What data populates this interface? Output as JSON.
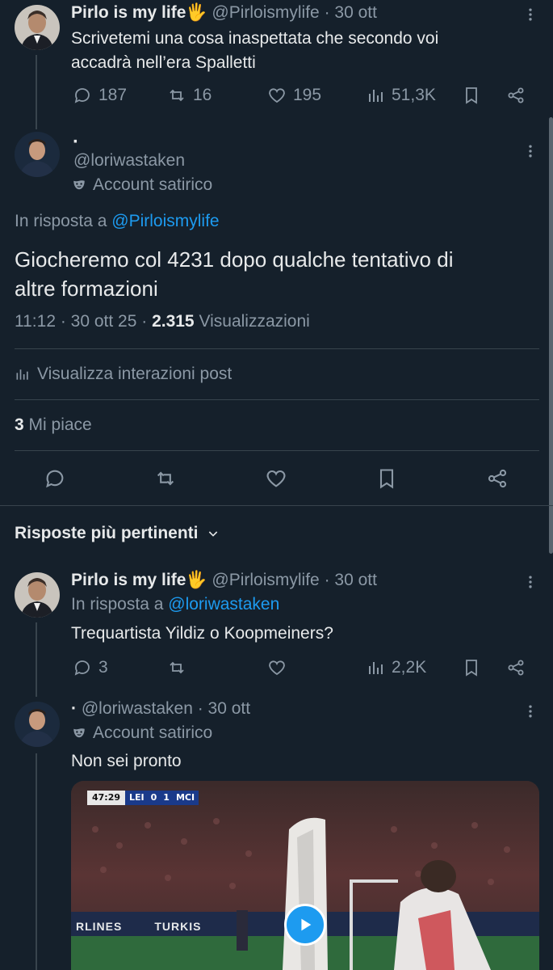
{
  "tweet1": {
    "name": "Pirlo is my life",
    "emoji": "🖐",
    "handle": "@Pirloismylife",
    "time": "· 30 ott",
    "text_line1": "Scrivetemi una cosa inaspettata che secondo voi",
    "text_line2": "accadrà nell’era Spalletti",
    "replies": "187",
    "retweets": "16",
    "likes": "195",
    "views": "51,3K"
  },
  "main": {
    "name": "·",
    "handle": "@loriwastaken",
    "badge": "Account satirico",
    "reply_prefix": "In risposta a",
    "reply_to": "@Pirloismylife",
    "text_line1": "Giocheremo col 4231 dopo qualche tentativo di",
    "text_line2": "altre formazioni",
    "meta_time": "11:12 · 30 ott 25 ·",
    "meta_views_count": "2.315",
    "meta_views_label": "Visualizzazioni",
    "interactions": "Visualizza interazioni post",
    "likes_count": "3",
    "likes_label": "Mi piace"
  },
  "replies_header": "Risposte più pertinenti",
  "reply1": {
    "name": "Pirlo is my life",
    "emoji": "🖐",
    "handle": "@Pirloismylife",
    "time": "· 30 ott",
    "reply_prefix": "In risposta a",
    "reply_to": "@loriwastaken",
    "text": "Trequartista Yildiz o Koopmeiners?",
    "replies": "3",
    "views": "2,2K"
  },
  "reply2": {
    "name": "·",
    "handle": "@loriwastaken",
    "time": "· 30 ott",
    "badge": "Account satirico",
    "text": "Non sei pronto",
    "scoreboard": {
      "clock": "47:29",
      "home": "LEI",
      "home_score": "0",
      "away_score": "1",
      "away": "MCI"
    },
    "banner_text_1": "RLINES",
    "banner_text_2": "TURKIS"
  },
  "colors": {
    "background": "#15202b",
    "text": "#e7e9ea",
    "muted": "#8b98a5",
    "accent": "#1d9bf0",
    "divider": "#38444d"
  }
}
